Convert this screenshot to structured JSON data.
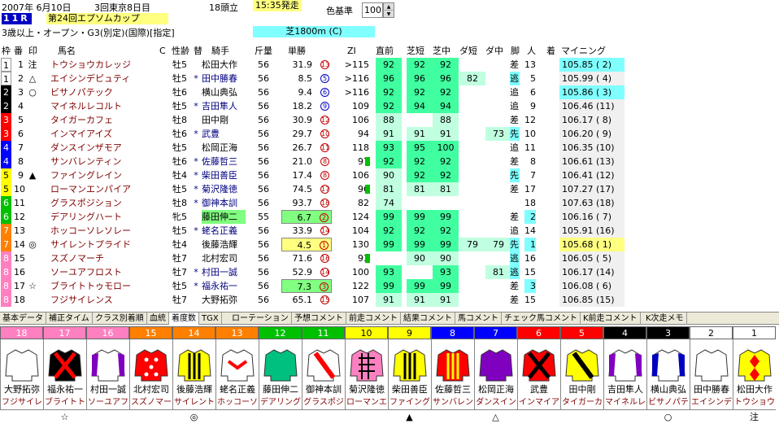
{
  "header": {
    "date": "2007年 6月10日",
    "kai": "3回東京8日目",
    "heads": "18頭立",
    "time": "15:35発走",
    "race_no": "11R",
    "race_name": "第24回エプソムカップ",
    "conditions": "3歳以上・オープン・G3(別定)(国際)[指定]",
    "course": "芝1800m (C)",
    "color_label": "色基準",
    "color_value": "100"
  },
  "columns": {
    "waku": "枠",
    "num": "番",
    "mark": "印",
    "name": "馬名",
    "c": "C",
    "sexage": "性齢",
    "prev": "替",
    "jockey": "騎手",
    "weight": "斤量",
    "odds": "単勝",
    "zi": "ZI",
    "chokuzen": "直前",
    "shiba_tan": "芝短",
    "shiba_naka": "芝中",
    "da_tan": "ダ短",
    "da_naka": "ダ中",
    "kyaku": "脚",
    "ninki": "人",
    "chaku": "着",
    "mining": "マイニング"
  },
  "colors": {
    "w1": "#ffffff",
    "w2": "#000000",
    "w3": "#ff0000",
    "w4": "#0000ff",
    "w5": "#ffff00",
    "w6": "#00c000",
    "w7": "#ff8000",
    "w8": "#ff80c0",
    "fig": "#40ffa0",
    "odds_hi": "#80ff80",
    "pref": "#80ffff"
  },
  "horses": [
    {
      "waku": "1",
      "num": "1",
      "mark": "注",
      "name": "トウショウカレッジ",
      "sexage": "牡5",
      "prev": "",
      "jockey": "松田大作",
      "weight": "56",
      "odds": "31.9",
      "pop": "13",
      "zi": ">115",
      "zibar": "",
      "f1": "92",
      "f2": "92",
      "f3": "92",
      "f4": "",
      "f5": "",
      "kyaku": "差",
      "ninki": "13",
      "mining": "105.85 ( 2)"
    },
    {
      "waku": "1",
      "num": "2",
      "mark": "△",
      "name": "エイシンデピュティ",
      "sexage": "牡5",
      "prev": "*",
      "jockey": "田中勝春",
      "weight": "56",
      "odds": "8.5",
      "pop": "5",
      "zi": ">116",
      "zibar": "",
      "f1": "96",
      "f2": "96",
      "f3": "96",
      "f4": "82",
      "f5": "",
      "kyaku": "逃",
      "ninki": "5",
      "mining": "105.99 ( 4)"
    },
    {
      "waku": "2",
      "num": "3",
      "mark": "○",
      "name": "ビサノパテック",
      "sexage": "牡6",
      "prev": "",
      "jockey": "横山典弘",
      "weight": "56",
      "odds": "9.4",
      "pop": "6",
      "zi": ">116",
      "zibar": "",
      "f1": "92",
      "f2": "92",
      "f3": "92",
      "f4": "",
      "f5": "",
      "kyaku": "追",
      "ninki": "6",
      "mining": "105.86 ( 3)"
    },
    {
      "waku": "2",
      "num": "4",
      "mark": "",
      "name": "マイネルレコルト",
      "sexage": "牡5",
      "prev": "*",
      "jockey": "吉田隼人",
      "weight": "56",
      "odds": "18.2",
      "pop": "9",
      "zi": "109",
      "zibar": "",
      "f1": "92",
      "f2": "94",
      "f3": "94",
      "f4": "",
      "f5": "",
      "kyaku": "追",
      "ninki": "9",
      "mining": "106.46 (11)"
    },
    {
      "waku": "3",
      "num": "5",
      "mark": "",
      "name": "タイガーカフェ",
      "sexage": "牡8",
      "prev": "",
      "jockey": "田中剛",
      "weight": "56",
      "odds": "30.9",
      "pop": "12",
      "zi": "106",
      "zibar": "",
      "f1": "88",
      "f2": "",
      "f3": "88",
      "f4": "",
      "f5": "",
      "kyaku": "差",
      "ninki": "12",
      "mining": "106.17 ( 8)"
    },
    {
      "waku": "3",
      "num": "6",
      "mark": "",
      "name": "インマイアイズ",
      "sexage": "牡6",
      "prev": "*",
      "jockey": "武豊",
      "weight": "56",
      "odds": "29.7",
      "pop": "10",
      "zi": "94",
      "zibar": "",
      "f1": "91",
      "f2": "91",
      "f3": "91",
      "f4": "",
      "f5": "73",
      "kyaku": "先",
      "ninki": "10",
      "mining": "106.20 ( 9)"
    },
    {
      "waku": "4",
      "num": "7",
      "mark": "",
      "name": "ダンスインザモア",
      "sexage": "牡5",
      "prev": "",
      "jockey": "松岡正海",
      "weight": "56",
      "odds": "26.7",
      "pop": "11",
      "zi": "118",
      "zibar": "",
      "f1": "93",
      "f2": "95",
      "f3": "100",
      "f4": "",
      "f5": "",
      "kyaku": "追",
      "ninki": "11",
      "mining": "106.35 (10)"
    },
    {
      "waku": "4",
      "num": "8",
      "mark": "",
      "name": "サンバレンティン",
      "sexage": "牡6",
      "prev": "*",
      "jockey": "佐藤哲三",
      "weight": "56",
      "odds": "21.0",
      "pop": "8",
      "zi": "97",
      "zibar": "g",
      "f1": "92",
      "f2": "92",
      "f3": "92",
      "f4": "",
      "f5": "",
      "kyaku": "差",
      "ninki": "8",
      "mining": "106.61 (13)"
    },
    {
      "waku": "5",
      "num": "9",
      "mark": "▲",
      "name": "ファイングレイン",
      "sexage": "牡4",
      "prev": "*",
      "jockey": "柴田善臣",
      "weight": "56",
      "odds": "17.4",
      "pop": "8",
      "zi": "106",
      "zibar": "",
      "f1": "90",
      "f2": "92",
      "f3": "92",
      "f4": "",
      "f5": "",
      "kyaku": "先",
      "ninki": "7",
      "mining": "106.41 (12)"
    },
    {
      "waku": "5",
      "num": "10",
      "mark": "",
      "name": "ローマンエンパイア",
      "sexage": "牡5",
      "prev": "*",
      "jockey": "菊沢隆徳",
      "weight": "56",
      "odds": "74.5",
      "pop": "17",
      "zi": "96",
      "zibar": "g",
      "f1": "81",
      "f2": "81",
      "f3": "81",
      "f4": "",
      "f5": "",
      "kyaku": "差",
      "ninki": "17",
      "mining": "107.27 (17)"
    },
    {
      "waku": "6",
      "num": "11",
      "mark": "",
      "name": "グラスポジション",
      "sexage": "牡8",
      "prev": "*",
      "jockey": "御神本訓",
      "weight": "56",
      "odds": "93.7",
      "pop": "18",
      "zi": "82",
      "zibar": "",
      "f1": "74",
      "f2": "",
      "f3": "",
      "f4": "",
      "f5": "",
      "kyaku": "",
      "ninki": "18",
      "mining": "107.63 (18)"
    },
    {
      "waku": "6",
      "num": "12",
      "mark": "",
      "name": "デアリングハート",
      "sexage": "牝5",
      "prev": "",
      "jockey": "藤田伸二",
      "weight": "55",
      "odds": "6.7",
      "pop": "2",
      "zi": "124",
      "zibar": "",
      "f1": "99",
      "f2": "99",
      "f3": "99",
      "f4": "",
      "f5": "",
      "kyaku": "差",
      "ninki": "2",
      "mining": "106.16 ( 7)"
    },
    {
      "waku": "7",
      "num": "13",
      "mark": "",
      "name": "ホッコーソレソレー",
      "sexage": "牡5",
      "prev": "*",
      "jockey": "蛯名正義",
      "weight": "56",
      "odds": "33.9",
      "pop": "14",
      "zi": "104",
      "zibar": "",
      "f1": "92",
      "f2": "92",
      "f3": "92",
      "f4": "",
      "f5": "",
      "kyaku": "追",
      "ninki": "14",
      "mining": "105.91 (16)"
    },
    {
      "waku": "7",
      "num": "14",
      "mark": "◎",
      "name": "サイレントプライド",
      "sexage": "牡4",
      "prev": "",
      "jockey": "後藤浩輝",
      "weight": "56",
      "odds": "4.5",
      "pop": "1",
      "zi": "130",
      "zibar": "",
      "f1": "99",
      "f2": "99",
      "f3": "99",
      "f4": "79",
      "f5": "79",
      "kyaku": "先",
      "ninki": "1",
      "mining": "105.68 ( 1)"
    },
    {
      "waku": "8",
      "num": "15",
      "mark": "",
      "name": "スズノマーチ",
      "sexage": "牡7",
      "prev": "",
      "jockey": "北村宏司",
      "weight": "56",
      "odds": "71.6",
      "pop": "16",
      "zi": "93",
      "zibar": "g",
      "f1": "",
      "f2": "90",
      "f3": "90",
      "f4": "",
      "f5": "",
      "kyaku": "逃",
      "ninki": "16",
      "mining": "106.05 ( 5)"
    },
    {
      "waku": "8",
      "num": "16",
      "mark": "",
      "name": "ソーユアフロスト",
      "sexage": "牡7",
      "prev": "*",
      "jockey": "村田一誠",
      "weight": "56",
      "odds": "52.9",
      "pop": "14",
      "zi": "100",
      "zibar": "",
      "f1": "93",
      "f2": "",
      "f3": "93",
      "f4": "",
      "f5": "81",
      "kyaku": "逃",
      "ninki": "15",
      "mining": "106.17 (14)"
    },
    {
      "waku": "8",
      "num": "17",
      "mark": "☆",
      "name": "ブライトトゥモロー",
      "sexage": "牡5",
      "prev": "*",
      "jockey": "福永祐一",
      "weight": "56",
      "odds": "7.3",
      "pop": "3",
      "zi": "122",
      "zibar": "",
      "f1": "99",
      "f2": "99",
      "f3": "99",
      "f4": "",
      "f5": "",
      "kyaku": "差",
      "ninki": "3",
      "mining": "106.08 ( 6)"
    },
    {
      "waku": "8",
      "num": "18",
      "mark": "",
      "name": "フジサイレンス",
      "sexage": "牡7",
      "prev": "",
      "jockey": "大野拓弥",
      "weight": "56",
      "odds": "65.1",
      "pop": "15",
      "zi": "107",
      "zibar": "",
      "f1": "91",
      "f2": "91",
      "f3": "91",
      "f4": "",
      "f5": "",
      "kyaku": "差",
      "ninki": "15",
      "mining": "106.85 (15)"
    }
  ],
  "tabs": [
    "基本データ",
    "補正タイム",
    "クラス別着順",
    "血統",
    "着度数",
    "TGX",
    "ローテーション",
    "予想コメント",
    "前走コメント",
    "結果コメント",
    "馬コメント",
    "チェック馬コメント",
    "K前走コメント",
    "K次走メモ"
  ],
  "bottom": [
    {
      "no": "18",
      "jockey": "大野拓弥",
      "horse": "フジサイレン",
      "mark": ""
    },
    {
      "no": "17",
      "jockey": "福永祐一",
      "horse": "ブライトトゥモ",
      "mark": "☆"
    },
    {
      "no": "16",
      "jockey": "村田一誠",
      "horse": "ソーユアフロ",
      "mark": ""
    },
    {
      "no": "15",
      "jockey": "北村宏司",
      "horse": "スズノマーチ",
      "mark": ""
    },
    {
      "no": "14",
      "jockey": "後藤浩輝",
      "horse": "サイレントプ",
      "mark": "◎"
    },
    {
      "no": "13",
      "jockey": "蛯名正義",
      "horse": "ホッコーソレ",
      "mark": ""
    },
    {
      "no": "12",
      "jockey": "藤田伸二",
      "horse": "デアリングハ",
      "mark": ""
    },
    {
      "no": "11",
      "jockey": "御神本訓",
      "horse": "グラスポジシ",
      "mark": ""
    },
    {
      "no": "10",
      "jockey": "菊沢隆徳",
      "horse": "ローマンエン",
      "mark": ""
    },
    {
      "no": "9",
      "jockey": "柴田善臣",
      "horse": "ファイングレ",
      "mark": "▲"
    },
    {
      "no": "8",
      "jockey": "佐藤哲三",
      "horse": "サンバレンテ",
      "mark": ""
    },
    {
      "no": "7",
      "jockey": "松岡正海",
      "horse": "ダンスインザ",
      "mark": "△"
    },
    {
      "no": "6",
      "jockey": "武豊",
      "horse": "インマイアイ",
      "mark": ""
    },
    {
      "no": "5",
      "jockey": "田中剛",
      "horse": "タイガーカフ",
      "mark": ""
    },
    {
      "no": "4",
      "jockey": "吉田隼人",
      "horse": "マイネルレコ",
      "mark": ""
    },
    {
      "no": "3",
      "jockey": "横山典弘",
      "horse": "ビサノパテッ",
      "mark": "○"
    },
    {
      "no": "2",
      "jockey": "田中勝春",
      "horse": "エイシンデピ",
      "mark": ""
    },
    {
      "no": "1",
      "jockey": "松田大作",
      "horse": "トウショウカ",
      "mark": "注"
    }
  ]
}
